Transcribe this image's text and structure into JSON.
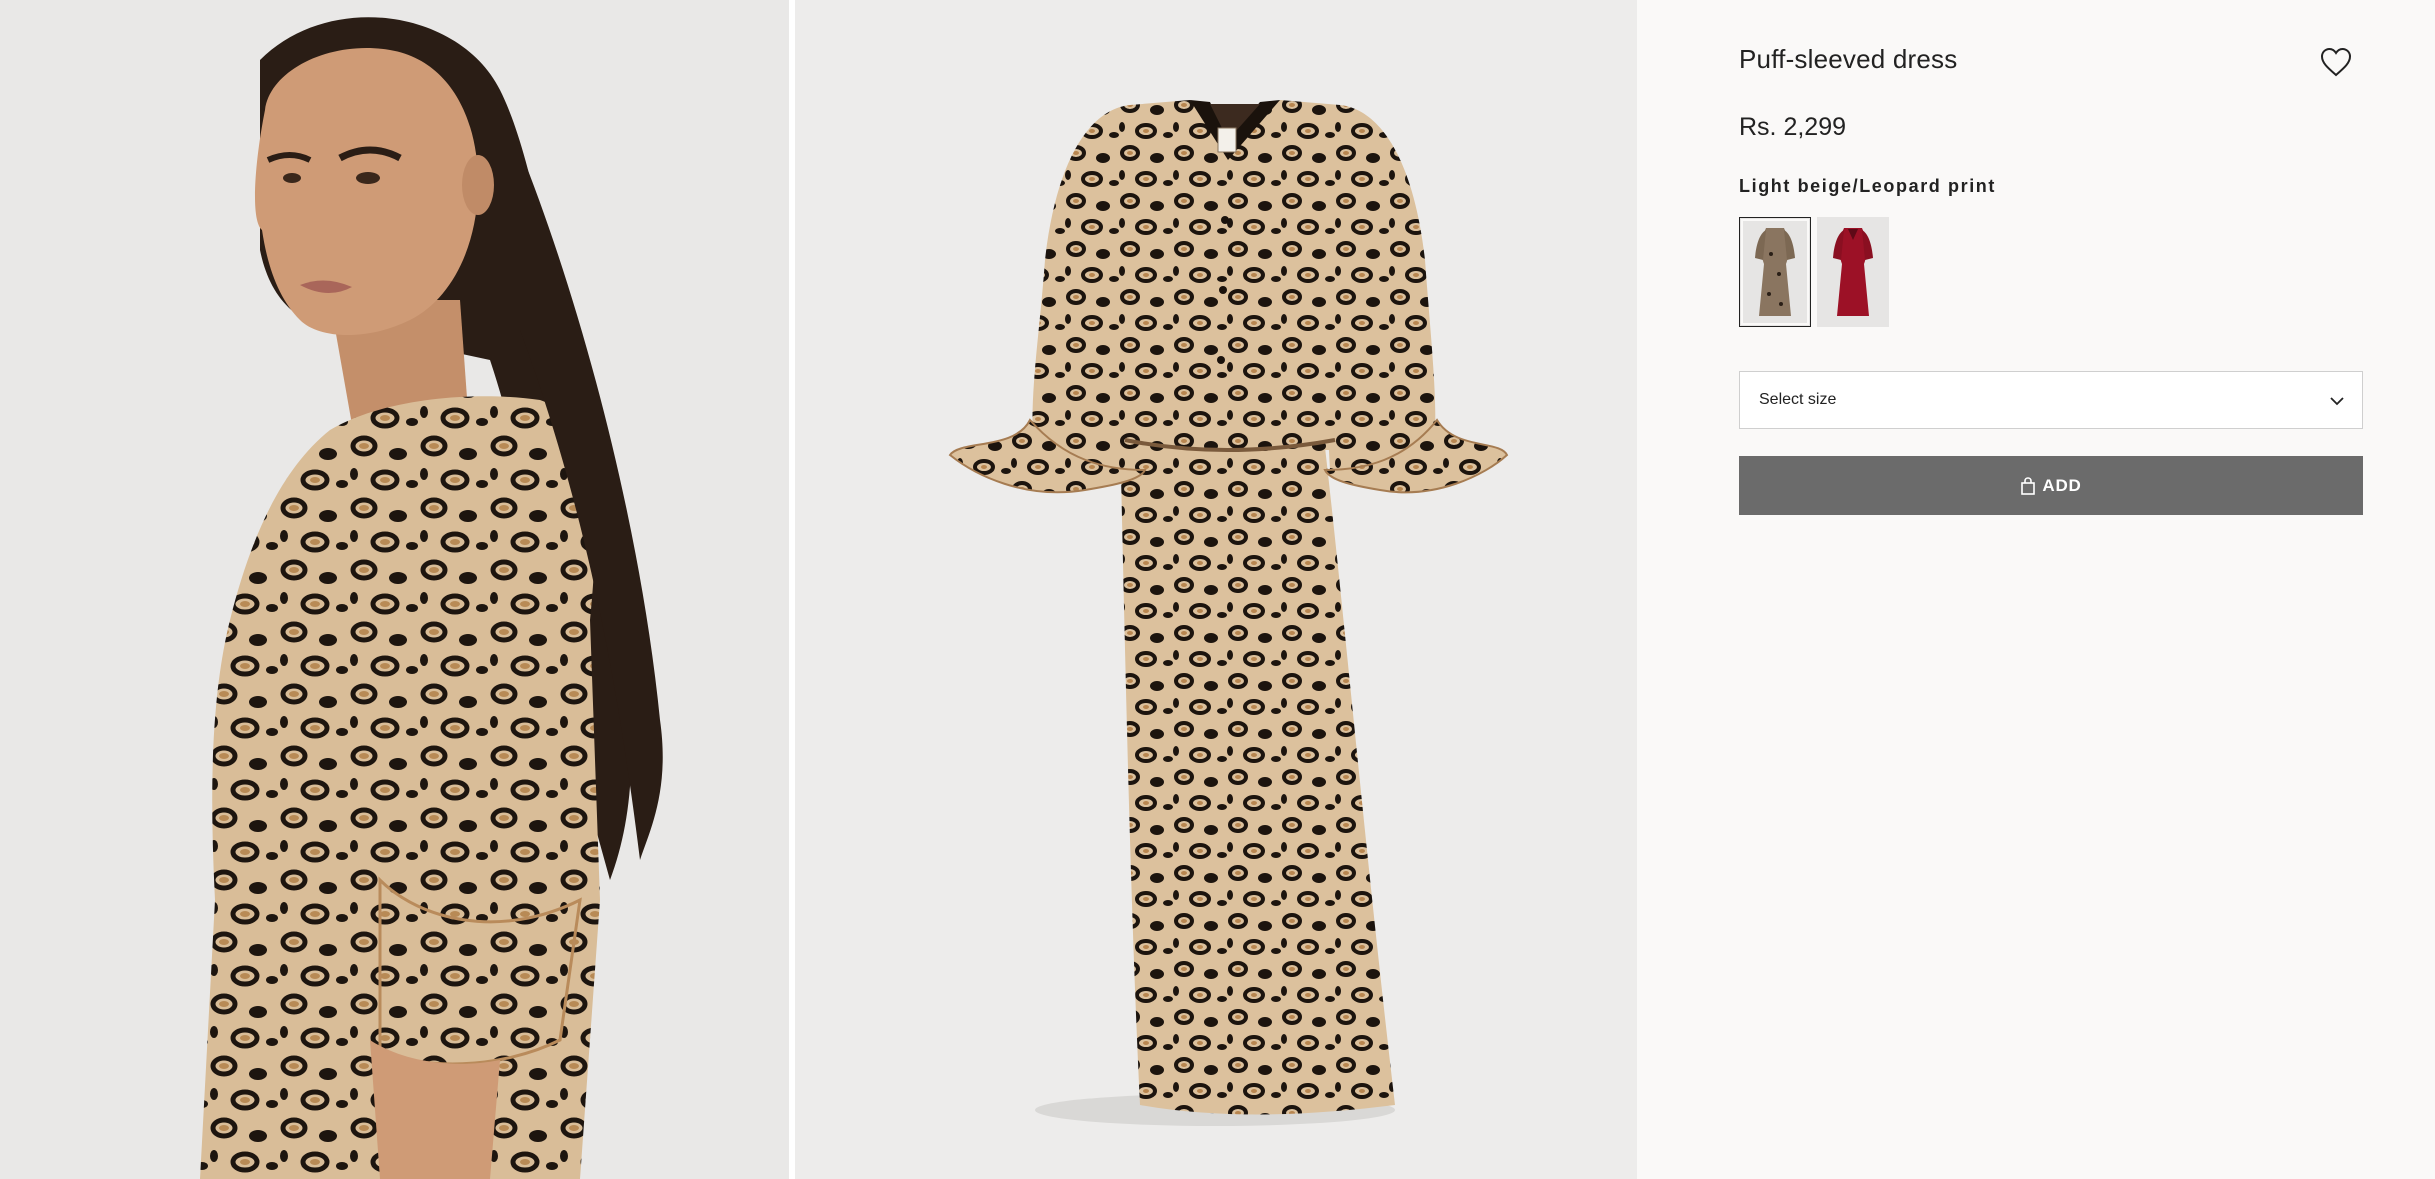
{
  "product": {
    "title": "Puff-sleeved dress",
    "price": "Rs. 2,299",
    "color_name": "Light beige/Leopard print",
    "favorite_icon": "heart-outline-icon"
  },
  "swatches": [
    {
      "name": "Light beige/Leopard print",
      "color": "#8a7560",
      "selected": true
    },
    {
      "name": "Red",
      "color": "#9c1126",
      "selected": false
    }
  ],
  "size_select": {
    "label": "Select size",
    "icon": "chevron-down-icon"
  },
  "add_button": {
    "label": "ADD",
    "icon": "shopping-bag-icon"
  },
  "images": [
    {
      "name": "model-photo"
    },
    {
      "name": "product-photo"
    }
  ],
  "colors": {
    "background": "#faf9f8",
    "add_button": "#6b6b6b",
    "leopard_base": "#d8b993",
    "leopard_spot": "#1c140e"
  }
}
